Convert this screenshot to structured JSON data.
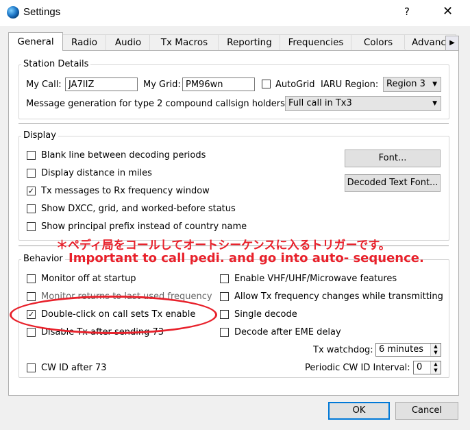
{
  "window": {
    "title": "Settings",
    "help_glyph": "?",
    "close_glyph": "✕"
  },
  "tabs": [
    {
      "label": "General",
      "active": true
    },
    {
      "label": "Radio"
    },
    {
      "label": "Audio"
    },
    {
      "label": "Tx Macros"
    },
    {
      "label": "Reporting"
    },
    {
      "label": "Frequencies"
    },
    {
      "label": "Colors"
    },
    {
      "label": "Advanced"
    }
  ],
  "tab_scroll_glyph": "▶",
  "station": {
    "group_label": "Station Details",
    "my_call_label": "My Call:",
    "my_call_value": "JA7IIZ",
    "my_grid_label": "My Grid:",
    "my_grid_value": "PM96wn",
    "autogrid_label": "AutoGrid",
    "autogrid_checked": false,
    "iaru_label": "IARU Region:",
    "iaru_value": "Region 3",
    "message_gen_label": "Message generation for type 2 compound callsign holders:",
    "message_gen_value": "Full call in Tx3"
  },
  "display": {
    "group_label": "Display",
    "options": [
      {
        "label": "Blank line between decoding periods",
        "checked": false
      },
      {
        "label": "Display distance in miles",
        "checked": false
      },
      {
        "label": "Tx messages to Rx frequency window",
        "checked": true
      },
      {
        "label": "Show DXCC, grid, and worked-before status",
        "checked": false
      },
      {
        "label": "Show principal prefix instead of country name",
        "checked": false
      }
    ],
    "font_button": "Font...",
    "decoded_font_button": "Decoded Text Font..."
  },
  "annotation": {
    "japanese": "＊ペディ局をコールしてオートシーケンスに入るトリガーです。",
    "english": "Important to call pedi. and go into auto- sequence."
  },
  "behavior": {
    "group_label": "Behavior",
    "left_options": [
      {
        "label": "Monitor off at startup",
        "checked": false
      },
      {
        "label": "Monitor returns to last used frequency",
        "checked": false
      },
      {
        "label": "Double-click on call sets Tx enable",
        "checked": true
      },
      {
        "label": "Disable Tx after sending 73",
        "checked": false
      },
      {
        "label": "CW ID after 73",
        "checked": false
      }
    ],
    "right_options": [
      {
        "label": "Enable VHF/UHF/Microwave features",
        "checked": false
      },
      {
        "label": "Allow Tx frequency changes while transmitting",
        "checked": false
      },
      {
        "label": "Single decode",
        "checked": false
      },
      {
        "label": "Decode after EME delay",
        "checked": false
      }
    ],
    "tx_watchdog_label": "Tx watchdog:",
    "tx_watchdog_value": "6 minutes",
    "periodic_cw_label": "Periodic CW ID Interval:",
    "periodic_cw_value": "0"
  },
  "footer": {
    "ok_label": "OK",
    "cancel_label": "Cancel"
  },
  "glyphs": {
    "check": "✓",
    "combo_arrow": "▼",
    "spin_up": "▲",
    "spin_down": "▼"
  },
  "colors": {
    "annotation": "#e8212b",
    "default_button_border": "#0078d7"
  }
}
